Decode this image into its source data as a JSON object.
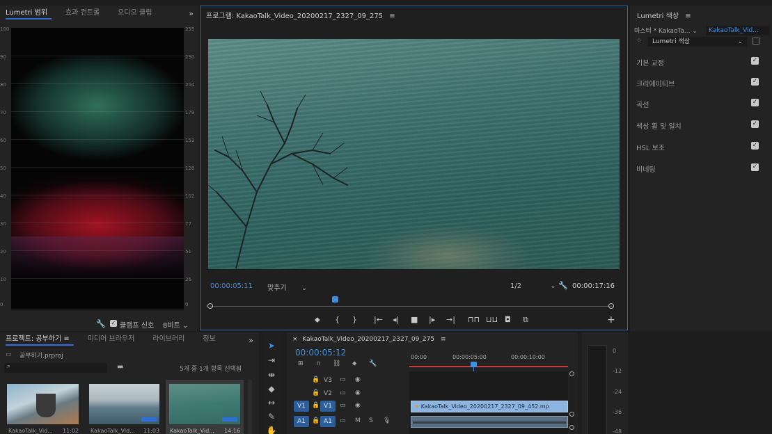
{
  "scopes": {
    "tabs": [
      "Lumetri 범위",
      "효과 컨트롤",
      "오디오 클립"
    ],
    "left_ticks": [
      "100",
      "90",
      "80",
      "70",
      "60",
      "50",
      "40",
      "30",
      "20",
      "10",
      "0"
    ],
    "right_ticks": [
      "255",
      "230",
      "204",
      "179",
      "153",
      "128",
      "102",
      "77",
      "51",
      "26",
      "0"
    ],
    "clamp_label": "클램프 신호",
    "bit_label": "8비트"
  },
  "program": {
    "title": "프로그램: KakaoTalk_Video_20200217_2327_09_275",
    "current_time": "00:00:05:11",
    "fit_label": "맞추기",
    "resolution": "1/2",
    "duration": "00:00:17:16",
    "playhead_fraction": 0.31
  },
  "lumetri": {
    "title": "Lumetri 색상",
    "master_label": "마스터 * KakaoTa...",
    "clip_label": "KakaoTalk_Vid...",
    "effect_select": "Lumetri 색상",
    "sections": [
      {
        "label": "기본 교정",
        "checked": true
      },
      {
        "label": "크리에이티브",
        "checked": true
      },
      {
        "label": "곡선",
        "checked": true
      },
      {
        "label": "색상 휠 및 일치",
        "checked": true
      },
      {
        "label": "HSL 보조",
        "checked": true
      },
      {
        "label": "비네팅",
        "checked": true
      }
    ]
  },
  "project": {
    "tabs": [
      "프로젝트: 공부하기",
      "미디어 브라우저",
      "라이브러리",
      "정보"
    ],
    "file": "공부하기.prproj",
    "selection_info": "5개 중 1개 항목 선택됨",
    "clips": [
      {
        "name": "KakaoTalk_Vid...",
        "duration": "11:02"
      },
      {
        "name": "KakaoTalk_Vid...",
        "duration": "11:03"
      },
      {
        "name": "KakaoTalk_Vid...",
        "duration": "14:16"
      }
    ]
  },
  "timeline": {
    "tab": "KakaoTalk_Video_20200217_2327_09_275",
    "timecode": "00:00:05:12",
    "ruler": [
      "00:00",
      "00:00:05:00",
      "00:00:10:00"
    ],
    "tracks": [
      "V3",
      "V2",
      "V1",
      "A1"
    ],
    "source_v": "V1",
    "source_a": "A1",
    "clip_name": "KakaoTalk_Video_20200217_2327_09_452.mp"
  },
  "meters": {
    "ticks": [
      "0",
      "-12",
      "-24",
      "-36",
      "-48"
    ]
  },
  "colors": {
    "accent": "#2e6fd6",
    "timecode_blue": "#3d8fe3",
    "clip_blue": "#8cb4e0"
  }
}
